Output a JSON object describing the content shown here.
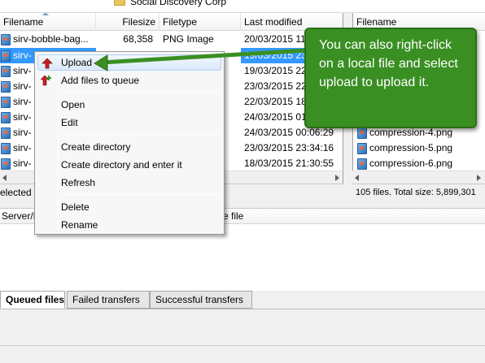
{
  "remote_tree": {
    "folder_name": "Social Discovery Corp"
  },
  "local": {
    "columns": [
      "Filename",
      "Filesize",
      "Filetype",
      "Last modified"
    ],
    "rows": [
      {
        "name": "sirv-bobble-bag...",
        "size": "68,358",
        "type": "PNG Image",
        "modified": "20/03/2015 11:..."
      },
      {
        "name": "sirv-",
        "size": "",
        "type": "",
        "modified": "19/03/2015 23:..."
      },
      {
        "name": "sirv-",
        "size": "",
        "type": "",
        "modified": "19/03/2015 22:..."
      },
      {
        "name": "sirv-",
        "size": "",
        "type": "",
        "modified": "23/03/2015 22:..."
      },
      {
        "name": "sirv-",
        "size": "",
        "type": "",
        "modified": "22/03/2015 18:..."
      },
      {
        "name": "sirv-",
        "size": "",
        "type": "",
        "modified": "24/03/2015 01:..."
      },
      {
        "name": "sirv-",
        "size": "",
        "type": "",
        "modified": "24/03/2015 00:06:29"
      },
      {
        "name": "sirv-",
        "size": "",
        "type": "",
        "modified": "23/03/2015 23:34:16"
      },
      {
        "name": "sirv-",
        "size": "",
        "type": "",
        "modified": "18/03/2015 21:30:55"
      }
    ],
    "status": "elected"
  },
  "remote": {
    "column": "Filename",
    "files": [
      "compression-4.png",
      "compression-5.png",
      "compression-6.png"
    ],
    "status": "105 files. Total size: 5,899,301"
  },
  "queue": {
    "columns": [
      "Server/L",
      "e file"
    ]
  },
  "tabs": [
    "Queued files",
    "Failed transfers",
    "Successful transfers"
  ],
  "context_menu": {
    "items": [
      {
        "label": "Upload",
        "icon": "upload-arrow-icon"
      },
      {
        "label": "Add files to queue",
        "icon": "add-to-queue-icon"
      },
      {
        "label": "Open"
      },
      {
        "label": "Edit"
      },
      {
        "label": "Create directory"
      },
      {
        "label": "Create directory and enter it"
      },
      {
        "label": "Refresh"
      },
      {
        "label": "Delete"
      },
      {
        "label": "Rename"
      }
    ]
  },
  "callout": {
    "text": "You can also right-click on a local file and select upload to upload it.",
    "color": "#3a8f23"
  }
}
